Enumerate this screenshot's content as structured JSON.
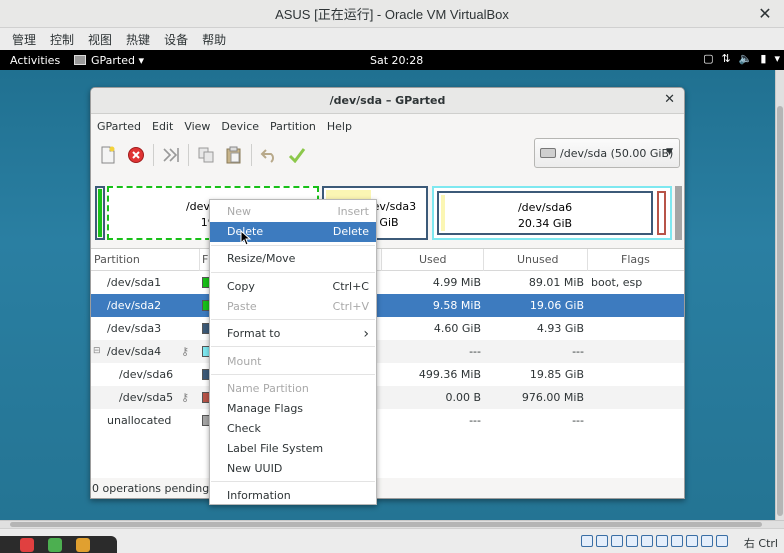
{
  "host": {
    "title": "ASUS [正在运行] - Oracle VM VirtualBox",
    "menu": [
      "管理",
      "控制",
      "视图",
      "热键",
      "设备",
      "帮助"
    ],
    "host_key": "右 Ctrl"
  },
  "gnome": {
    "activities": "Activities",
    "app_name": "GParted ▾",
    "clock": "Sat 20:28"
  },
  "gparted": {
    "title": "/dev/sda – GParted",
    "menu": [
      "GParted",
      "Edit",
      "View",
      "Device",
      "Partition",
      "Help"
    ],
    "device_select": "/dev/sda   (50.00 GiB)",
    "graph": {
      "sda2": {
        "name": "/dev/sda2",
        "size": "19.0"
      },
      "sda3": {
        "name": "/dev/sda3",
        "size": "GiB"
      },
      "sda6": {
        "name": "/dev/sda6",
        "size": "20.34 GiB"
      }
    },
    "columns": [
      "Partition",
      "F",
      "Used",
      "Unused",
      "Flags"
    ],
    "rows": [
      {
        "partition": "/dev/sda1",
        "used": "4.99 MiB",
        "unused": "89.01 MiB",
        "flags": "boot, esp",
        "color": "#18c018"
      },
      {
        "partition": "/dev/sda2",
        "used": "9.58 MiB",
        "unused": "19.06 GiB",
        "flags": "",
        "color": "#18c018"
      },
      {
        "partition": "/dev/sda3",
        "used": "4.60 GiB",
        "unused": "4.93 GiB",
        "flags": "",
        "color": "#3c5a78"
      },
      {
        "partition": "/dev/sda4",
        "used": "---",
        "unused": "---",
        "flags": "",
        "color": "#7ee8f0"
      },
      {
        "partition": "/dev/sda6",
        "used": "499.36 MiB",
        "unused": "19.85 GiB",
        "flags": "",
        "color": "#3c5a78"
      },
      {
        "partition": "/dev/sda5",
        "used": "0.00 B",
        "unused": "976.00 MiB",
        "flags": "",
        "color": "#b85448"
      },
      {
        "partition": "unallocated",
        "used": "---",
        "unused": "---",
        "flags": "",
        "color": "#a5a5a5"
      }
    ],
    "status": "0 operations pending"
  },
  "context_menu": {
    "new": {
      "label": "New",
      "accel": "Insert"
    },
    "delete": {
      "label": "Delete",
      "accel": "Delete"
    },
    "resize": {
      "label": "Resize/Move"
    },
    "copy": {
      "label": "Copy",
      "accel": "Ctrl+C"
    },
    "paste": {
      "label": "Paste",
      "accel": "Ctrl+V"
    },
    "format": {
      "label": "Format to",
      "accel": "›"
    },
    "mount": {
      "label": "Mount"
    },
    "name_partition": {
      "label": "Name Partition"
    },
    "manage_flags": {
      "label": "Manage Flags"
    },
    "check": {
      "label": "Check"
    },
    "label_fs": {
      "label": "Label File System"
    },
    "new_uuid": {
      "label": "New UUID"
    },
    "information": {
      "label": "Information"
    }
  }
}
